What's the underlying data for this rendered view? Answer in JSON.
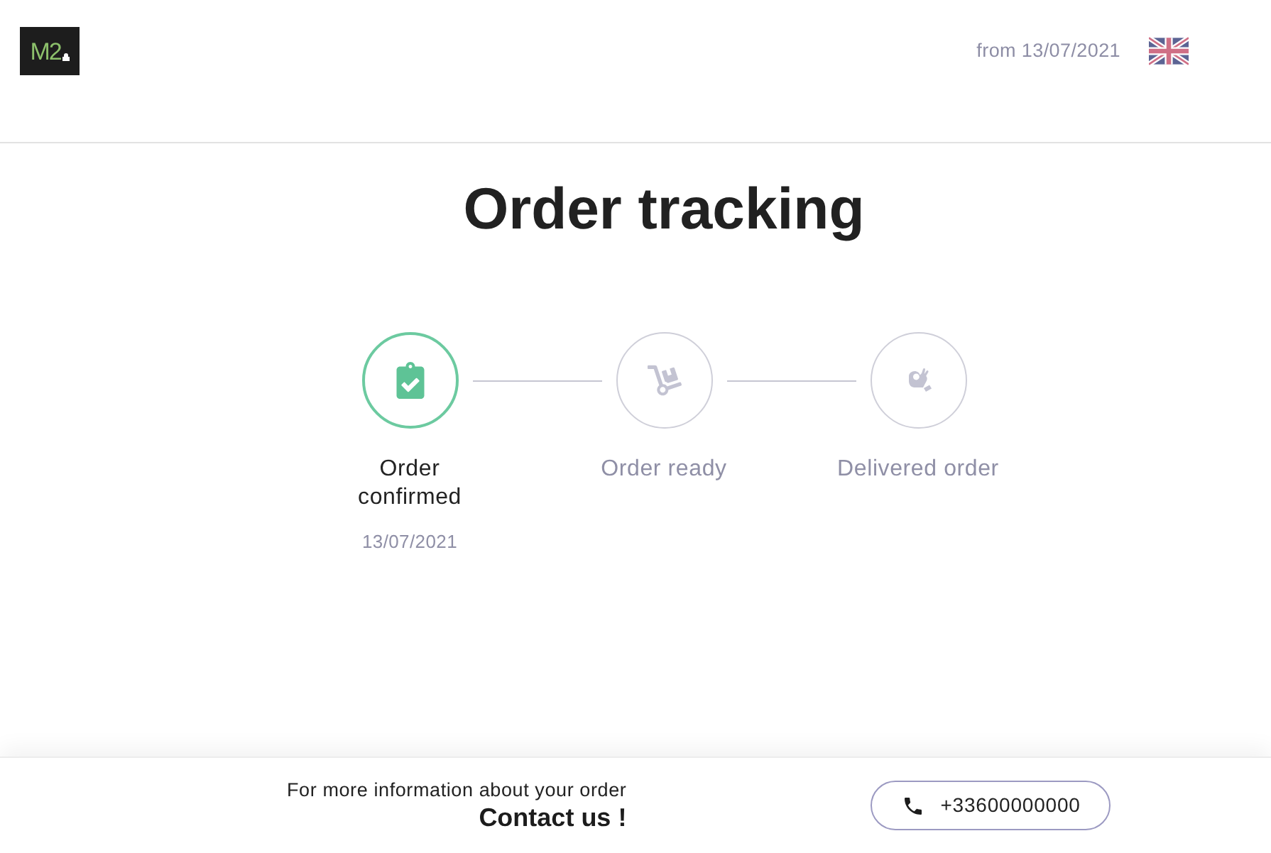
{
  "header": {
    "logo_text": "M2",
    "date_text": "from 13/07/2021"
  },
  "title": "Order tracking",
  "steps": [
    {
      "label": "Order confirmed",
      "date": "13/07/2021",
      "done": true
    },
    {
      "label": "Order ready",
      "done": false
    },
    {
      "label": "Delivered order",
      "done": false
    }
  ],
  "footer": {
    "info_text": "For more information about your order",
    "contact_label": "Contact us !",
    "phone": "+33600000000"
  }
}
